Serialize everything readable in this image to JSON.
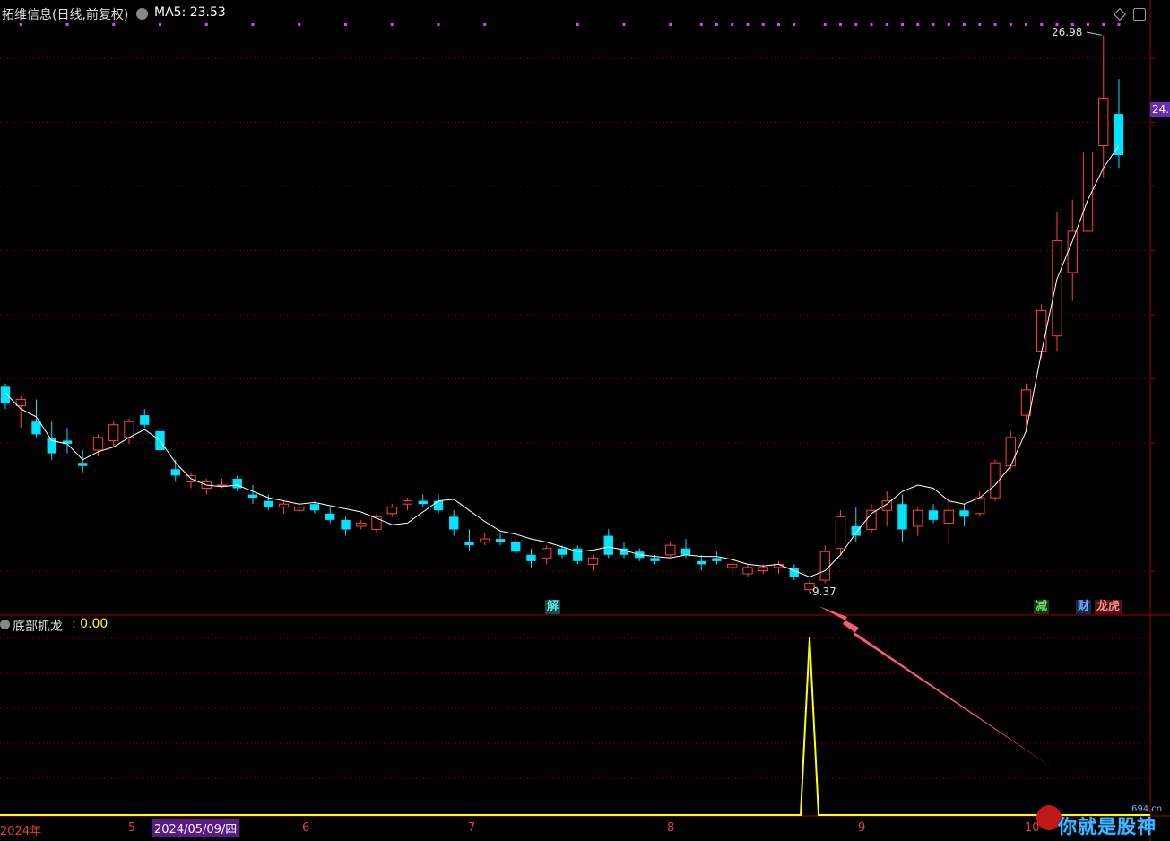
{
  "header": {
    "stock_name": "拓维信息(日线,前复权)",
    "ma_label": "MA5: 23.53",
    "ma_color": "#ffffff"
  },
  "price_axis": {
    "badge": "24."
  },
  "annotations": {
    "high_price": "26.98",
    "low_price": "9.37"
  },
  "event_tags": [
    {
      "text": "解",
      "color": "#2e8b8b"
    },
    {
      "text": "减",
      "color": "#2f8f2f"
    },
    {
      "text": "财",
      "color": "#3f6fd0"
    },
    {
      "text": "龙虎",
      "color": "#c04040"
    }
  ],
  "indicator": {
    "name": "底部抓龙",
    "value": ": 0.00",
    "line_color": "#ffff00"
  },
  "time_axis": {
    "labels": [
      "2024年",
      "5",
      "2024/05/09/四",
      "6",
      "7",
      "8",
      "9",
      "10"
    ]
  },
  "watermark": {
    "text": "你就是股神",
    "site": "694.cn"
  },
  "colors": {
    "up": "#ff4040",
    "down": "#00e5ff",
    "grid": "#8b0000",
    "signal_dots": "#e040ff"
  },
  "chart_data": {
    "type": "candlestick",
    "series": [
      {
        "name": "MA5",
        "values": [
          15.7,
          15.2,
          14.95,
          14.2,
          14.1,
          13.6,
          13.85,
          14.0,
          14.3,
          14.55,
          14.2,
          13.5,
          13.0,
          12.8,
          12.75,
          12.8,
          12.6,
          12.4,
          12.3,
          12.2,
          12.25,
          12.15,
          12.05,
          11.95,
          11.75,
          11.55,
          11.6,
          11.95,
          12.3,
          12.35,
          12.0,
          11.65,
          11.35,
          11.25,
          11.1,
          11.0,
          10.85,
          10.7,
          10.75,
          10.85,
          10.75,
          10.6,
          10.55,
          10.5,
          10.6,
          10.55,
          10.55,
          10.45,
          10.3,
          10.25,
          10.3,
          10.1,
          9.9,
          10.1,
          10.6,
          11.3,
          11.9,
          12.2,
          12.6,
          12.8,
          12.7,
          12.3,
          12.2,
          12.4,
          12.8,
          13.4,
          14.5,
          17.0,
          19.3,
          20.5,
          21.8,
          22.8,
          23.5
        ]
      }
    ],
    "values": [
      [
        15.9,
        16.0,
        15.2,
        15.4
      ],
      [
        15.3,
        15.6,
        14.6,
        15.5
      ],
      [
        14.8,
        15.5,
        14.3,
        14.4
      ],
      [
        14.3,
        14.8,
        13.6,
        13.8
      ],
      [
        14.2,
        14.6,
        13.8,
        14.1
      ],
      [
        13.5,
        13.9,
        13.2,
        13.4
      ],
      [
        13.9,
        14.4,
        13.7,
        14.3
      ],
      [
        14.2,
        14.8,
        14.0,
        14.7
      ],
      [
        14.3,
        14.9,
        14.1,
        14.8
      ],
      [
        15.0,
        15.2,
        14.6,
        14.7
      ],
      [
        14.5,
        14.7,
        13.7,
        13.9
      ],
      [
        13.3,
        13.6,
        12.9,
        13.1
      ],
      [
        12.9,
        13.2,
        12.7,
        13.1
      ],
      [
        12.7,
        13.0,
        12.5,
        12.9
      ],
      [
        12.8,
        13.0,
        12.7,
        12.8
      ],
      [
        13.0,
        13.1,
        12.6,
        12.7
      ],
      [
        12.5,
        12.8,
        12.2,
        12.4
      ],
      [
        12.3,
        12.5,
        12.0,
        12.1
      ],
      [
        12.1,
        12.3,
        11.9,
        12.2
      ],
      [
        12.0,
        12.2,
        11.9,
        12.1
      ],
      [
        12.2,
        12.3,
        11.9,
        12.0
      ],
      [
        11.9,
        12.1,
        11.6,
        11.7
      ],
      [
        11.7,
        11.8,
        11.2,
        11.4
      ],
      [
        11.5,
        11.7,
        11.4,
        11.6
      ],
      [
        11.4,
        11.9,
        11.3,
        11.8
      ],
      [
        11.9,
        12.2,
        11.8,
        12.1
      ],
      [
        12.2,
        12.4,
        12.0,
        12.3
      ],
      [
        12.3,
        12.5,
        12.1,
        12.2
      ],
      [
        12.3,
        12.5,
        11.9,
        12.0
      ],
      [
        11.8,
        12.0,
        11.2,
        11.4
      ],
      [
        11.0,
        11.4,
        10.7,
        10.9
      ],
      [
        11.0,
        11.3,
        10.9,
        11.1
      ],
      [
        11.1,
        11.3,
        10.9,
        11.0
      ],
      [
        11.0,
        11.1,
        10.6,
        10.7
      ],
      [
        10.6,
        10.8,
        10.2,
        10.4
      ],
      [
        10.5,
        10.9,
        10.3,
        10.8
      ],
      [
        10.8,
        10.9,
        10.5,
        10.6
      ],
      [
        10.8,
        10.9,
        10.3,
        10.4
      ],
      [
        10.3,
        10.6,
        10.1,
        10.5
      ],
      [
        11.2,
        11.4,
        10.5,
        10.6
      ],
      [
        10.8,
        11.0,
        10.5,
        10.6
      ],
      [
        10.7,
        10.8,
        10.4,
        10.5
      ],
      [
        10.5,
        10.6,
        10.3,
        10.4
      ],
      [
        10.6,
        11.0,
        10.5,
        10.9
      ],
      [
        10.8,
        11.1,
        10.5,
        10.6
      ],
      [
        10.4,
        10.6,
        10.1,
        10.3
      ],
      [
        10.5,
        10.7,
        10.3,
        10.4
      ],
      [
        10.2,
        10.5,
        10.0,
        10.3
      ],
      [
        10.0,
        10.3,
        9.9,
        10.2
      ],
      [
        10.1,
        10.3,
        10.0,
        10.2
      ],
      [
        10.2,
        10.4,
        10.0,
        10.3
      ],
      [
        10.2,
        10.3,
        9.8,
        9.9
      ],
      [
        9.5,
        9.8,
        9.4,
        9.7
      ],
      [
        9.8,
        10.9,
        9.7,
        10.7
      ],
      [
        10.8,
        12.0,
        10.6,
        11.8
      ],
      [
        11.5,
        12.1,
        11.0,
        11.2
      ],
      [
        11.4,
        12.2,
        11.3,
        12.0
      ],
      [
        12.0,
        12.6,
        11.5,
        12.3
      ],
      [
        12.2,
        12.5,
        11.0,
        11.4
      ],
      [
        11.5,
        12.1,
        11.2,
        12.0
      ],
      [
        12.0,
        12.2,
        11.6,
        11.7
      ],
      [
        11.6,
        12.3,
        11.0,
        12.0
      ],
      [
        12.0,
        12.2,
        11.5,
        11.8
      ],
      [
        11.9,
        12.6,
        11.8,
        12.4
      ],
      [
        12.4,
        13.6,
        12.3,
        13.5
      ],
      [
        13.4,
        14.5,
        13.3,
        14.3
      ],
      [
        15.0,
        16.0,
        14.5,
        15.8
      ],
      [
        17.0,
        18.5,
        16.8,
        18.3
      ],
      [
        17.5,
        21.4,
        17.0,
        20.5
      ],
      [
        19.5,
        21.8,
        18.6,
        20.8
      ],
      [
        20.8,
        23.8,
        20.2,
        23.3
      ],
      [
        23.5,
        26.98,
        22.5,
        25.0
      ],
      [
        24.5,
        25.6,
        22.8,
        23.2
      ]
    ],
    "ylim": [
      8.7,
      27.3
    ],
    "indicator_signal": {
      "name": "底部抓龙",
      "values": [
        0,
        0,
        0,
        0,
        0,
        0,
        0,
        0,
        0,
        0,
        0,
        0,
        0,
        0,
        0,
        0,
        0,
        0,
        0,
        0,
        0,
        0,
        0,
        0,
        0,
        0,
        0,
        0,
        0,
        0,
        0,
        0,
        0,
        0,
        0,
        0,
        0,
        0,
        0,
        0,
        0,
        0,
        0,
        0,
        0,
        0,
        0,
        0,
        0,
        0,
        0,
        0,
        1,
        0,
        0,
        0,
        0,
        0,
        0,
        0,
        0,
        0,
        0,
        0,
        0,
        0,
        0,
        0,
        0,
        0,
        0,
        0,
        0
      ]
    }
  }
}
